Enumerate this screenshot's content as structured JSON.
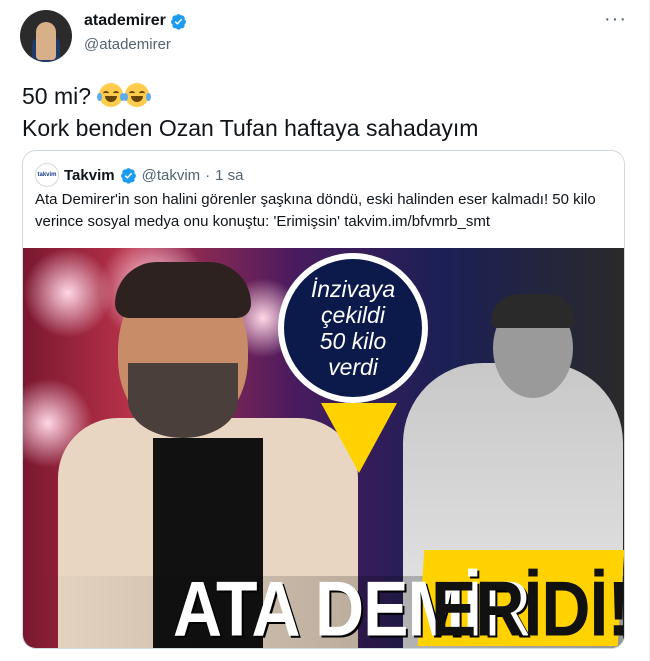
{
  "author": {
    "name": "atademirer",
    "handle": "@atademirer",
    "verified": true
  },
  "tweet": {
    "line1": "50 mi?",
    "line2": "Kork benden Ozan Tufan haftaya sahadayım",
    "emoji": [
      "face-with-tears-of-joy",
      "face-with-tears-of-joy"
    ]
  },
  "quoted": {
    "logo_text": "takvim",
    "name": "Takvim",
    "handle": "@takvim",
    "separator": "·",
    "time": "1 sa",
    "text": "Ata Demirer'in son halini görenler şaşkına döndü, eski halinden eser kalmadı! 50 kilo verince sosyal medya onu konuştu: 'Erimişsin' takvim.im/bfvmrb_smt",
    "media": {
      "badge_lines": [
        "İnzivaya",
        "çekildi",
        "50 kilo",
        "verdi"
      ],
      "headline_white": "ATA DEMİR",
      "headline_yellow": "ERİDİ!"
    }
  },
  "colors": {
    "verified_blue": "#1d9bf0",
    "muted_text": "#536471",
    "border": "#cfd9de",
    "badge_navy": "#0b1a4a",
    "headline_yellow": "#ffd200"
  },
  "icons": {
    "more": "more-horizontal-icon",
    "verified": "verified-badge-icon"
  }
}
